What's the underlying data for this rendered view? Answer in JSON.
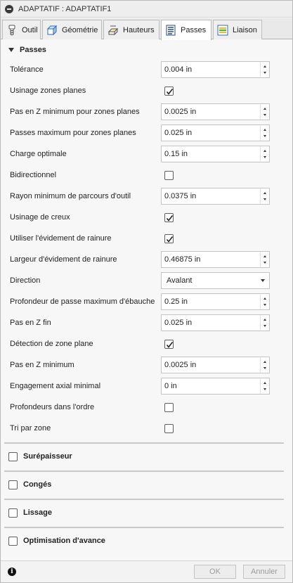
{
  "window": {
    "title": "ADAPTATIF : ADAPTATIF1"
  },
  "tabs": [
    {
      "label": "Outil",
      "icon": "tool-icon",
      "active": false
    },
    {
      "label": "Géométrie",
      "icon": "geometry-icon",
      "active": false
    },
    {
      "label": "Hauteurs",
      "icon": "heights-icon",
      "active": false
    },
    {
      "label": "Passes",
      "icon": "passes-icon",
      "active": true
    },
    {
      "label": "Liaison",
      "icon": "linking-icon",
      "active": false
    }
  ],
  "passes": {
    "header": "Passes",
    "rows": [
      {
        "label": "Tolérance",
        "type": "spin",
        "value": "0.004 in"
      },
      {
        "label": "Usinage zones planes",
        "type": "checkbox",
        "checked": true
      },
      {
        "label": "Pas en Z minimum pour zones planes",
        "type": "spin",
        "value": "0.0025 in"
      },
      {
        "label": "Passes maximum pour zones planes",
        "type": "spin",
        "value": "0.025 in"
      },
      {
        "label": "Charge optimale",
        "type": "spin",
        "value": "0.15 in"
      },
      {
        "label": "Bidirectionnel",
        "type": "checkbox",
        "checked": false
      },
      {
        "label": "Rayon minimum de parcours d'outil",
        "type": "spin",
        "value": "0.0375 in"
      },
      {
        "label": "Usinage de creux",
        "type": "checkbox",
        "checked": true
      },
      {
        "label": "Utiliser l'évidement de rainure",
        "type": "checkbox",
        "checked": true
      },
      {
        "label": "Largeur d'évidement de rainure",
        "type": "spin",
        "value": "0.46875 in"
      },
      {
        "label": "Direction",
        "type": "select",
        "value": "Avalant"
      },
      {
        "label": "Profondeur de passe maximum d'ébauche",
        "type": "spin",
        "value": "0.25 in"
      },
      {
        "label": "Pas en Z fin",
        "type": "spin",
        "value": "0.025 in"
      },
      {
        "label": "Détection de zone plane",
        "type": "checkbox",
        "checked": true
      },
      {
        "label": "Pas en Z minimum",
        "type": "spin",
        "value": "0.0025 in"
      },
      {
        "label": "Engagement axial minimal",
        "type": "spin",
        "value": "0 in"
      },
      {
        "label": "Profondeurs dans l'ordre",
        "type": "checkbox",
        "checked": false
      },
      {
        "label": "Tri par zone",
        "type": "checkbox",
        "checked": false
      }
    ]
  },
  "sections": [
    {
      "label": "Surépaisseur",
      "checked": false
    },
    {
      "label": "Congés",
      "checked": false
    },
    {
      "label": "Lissage",
      "checked": false
    },
    {
      "label": "Optimisation d'avance",
      "checked": false
    }
  ],
  "footer": {
    "ok_label": "OK",
    "cancel_label": "Annuler",
    "info_glyph": "i"
  }
}
